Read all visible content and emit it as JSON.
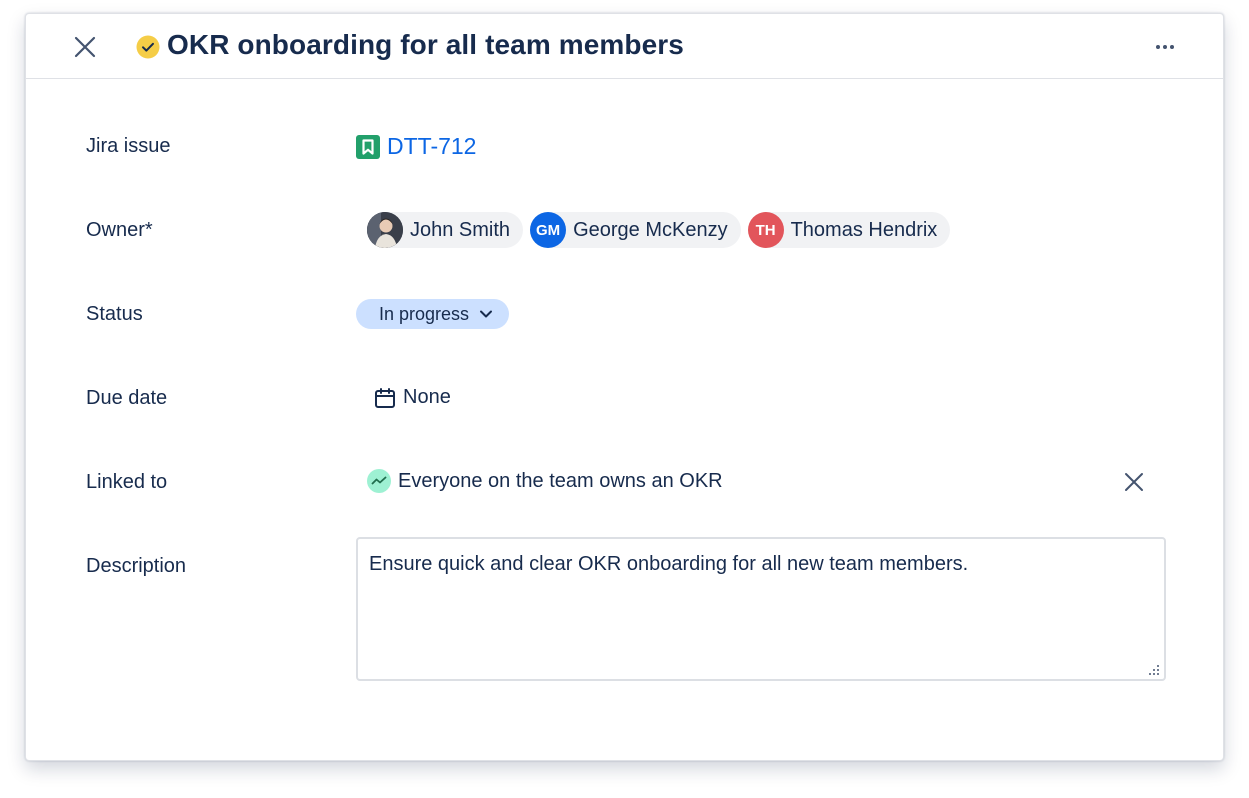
{
  "header": {
    "title": "OKR onboarding for all team members",
    "status_color": "#f5cd47"
  },
  "fields": {
    "jira_issue": {
      "label": "Jira issue",
      "key": "DTT-712",
      "icon_color": "#22a06b"
    },
    "owner": {
      "label": "Owner*",
      "people": [
        {
          "name": "John Smith",
          "initials": "",
          "color": "#44546f"
        },
        {
          "name": "George McKenzy",
          "initials": "GM",
          "color": "#0c66e4"
        },
        {
          "name": "Thomas Hendrix",
          "initials": "TH",
          "color": "#e2555b"
        }
      ]
    },
    "status": {
      "label": "Status",
      "value": "In progress",
      "color": "#cce0ff"
    },
    "due_date": {
      "label": "Due date",
      "value": "None"
    },
    "linked_to": {
      "label": "Linked to",
      "value": "Everyone on the team owns an OKR",
      "icon_color": "#9ef1d3"
    },
    "description": {
      "label": "Description",
      "value": "Ensure quick and clear OKR onboarding for all new team members."
    }
  }
}
